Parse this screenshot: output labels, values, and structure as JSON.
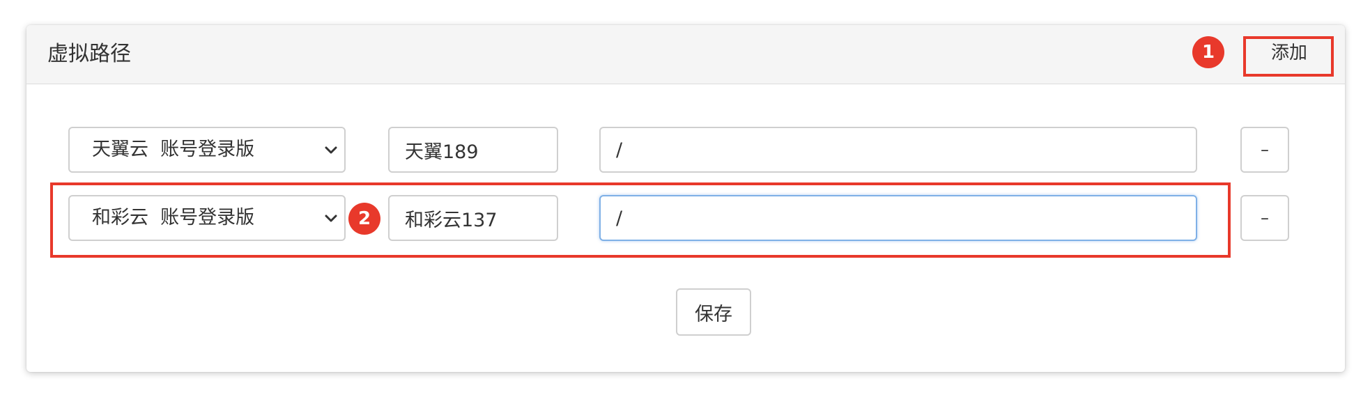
{
  "panel": {
    "title": "虚拟路径",
    "add_label": "添加"
  },
  "rows": [
    {
      "driver": "天翼云  账号登录版",
      "name": "天翼189",
      "path": "/",
      "remove_label": "–"
    },
    {
      "driver": "和彩云  账号登录版",
      "name": "和彩云137",
      "path": "/",
      "remove_label": "–"
    }
  ],
  "save_label": "保存",
  "callouts": [
    "1",
    "2"
  ],
  "colors": {
    "callout": "#e8392b",
    "focus_border": "#7fb0e6",
    "header_bg": "#f5f5f5"
  }
}
